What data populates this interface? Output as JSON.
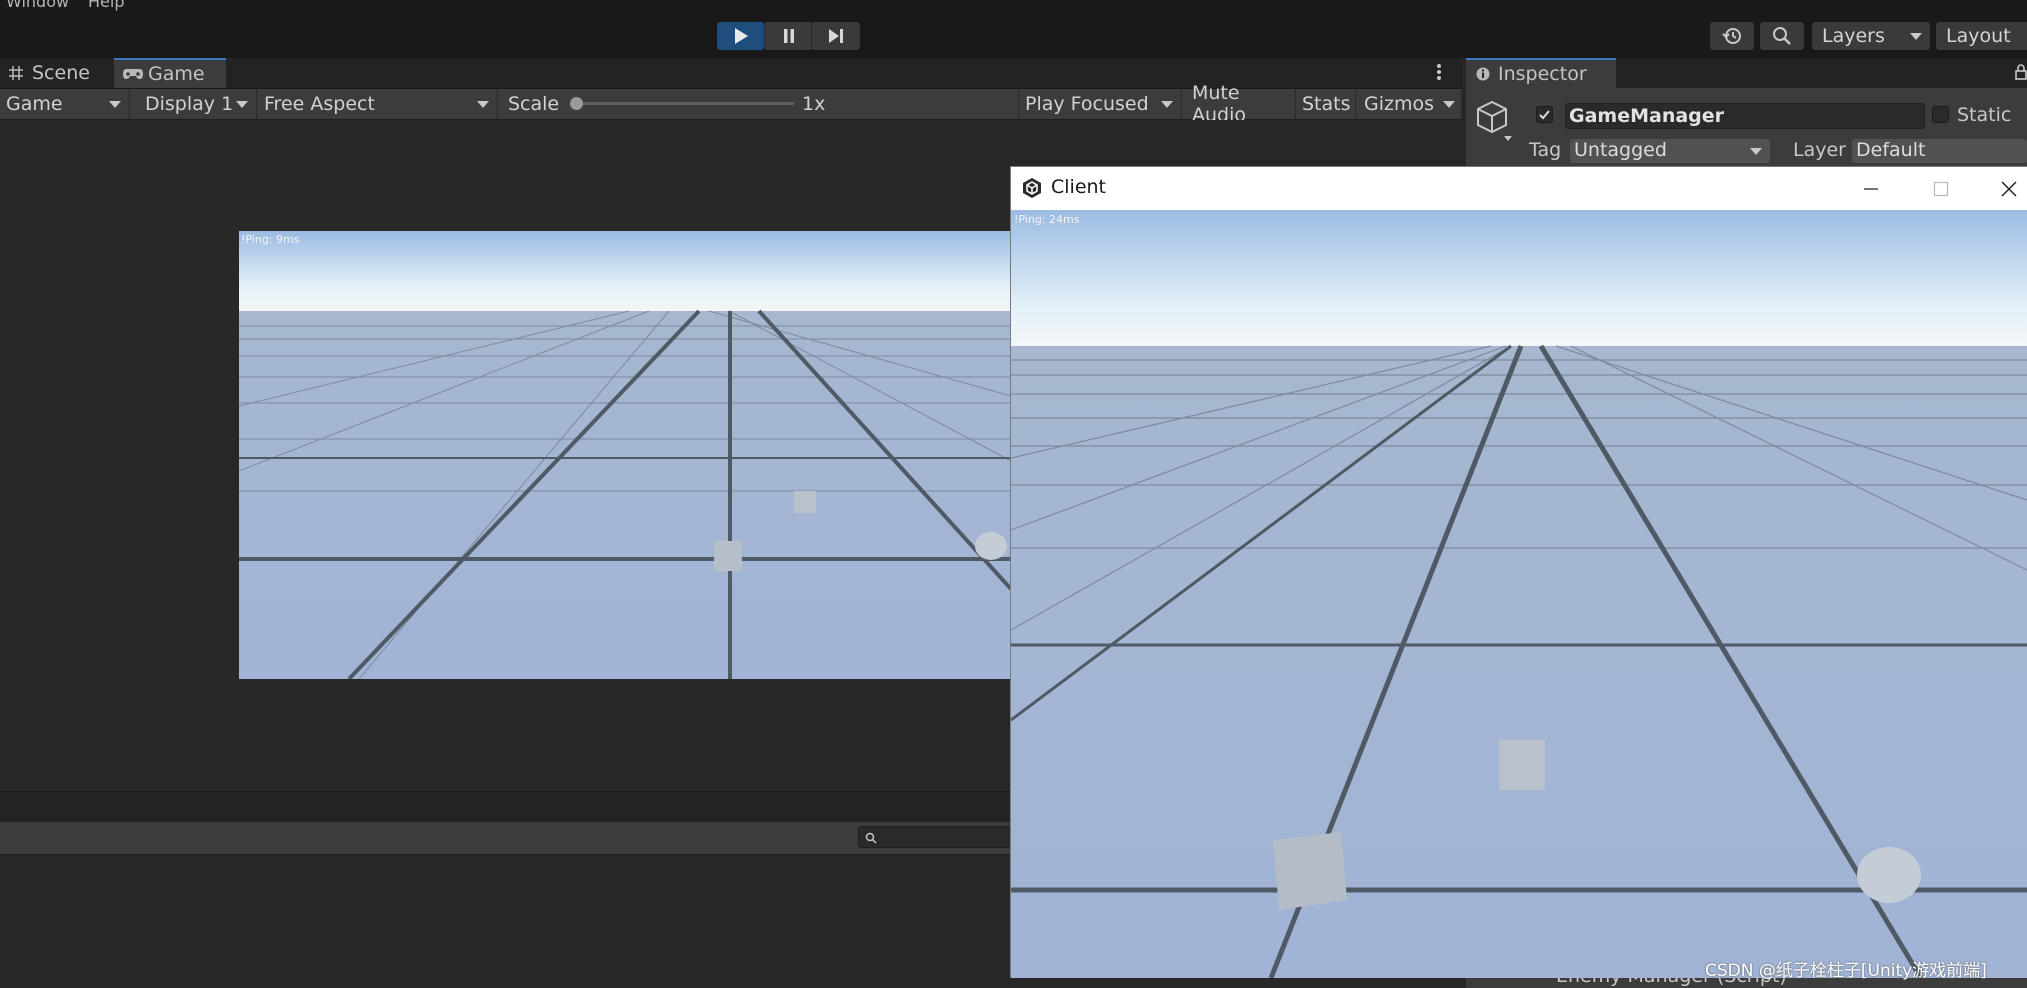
{
  "menu": {
    "items": [
      "Window",
      "Help"
    ]
  },
  "toolbar": {
    "play_icon": "play-icon",
    "pause_icon": "pause-icon",
    "step_icon": "step-icon",
    "history_icon": "history-icon",
    "search_icon": "search-icon",
    "layers_label": "Layers",
    "layout_label": "Layout",
    "accent": "#1e4d7e"
  },
  "tabs": {
    "scene": "Scene",
    "game": "Game"
  },
  "game_toolbar": {
    "mode": "Game",
    "display": "Display 1",
    "aspect": "Free Aspect",
    "scale_label": "Scale",
    "scale_value": "1x",
    "play_focused": "Play Focused",
    "mute_audio": "Mute Audio",
    "stats": "Stats",
    "gizmos": "Gizmos"
  },
  "game_view": {
    "ping": "!Ping: 9ms"
  },
  "inspector": {
    "tab_label": "Inspector",
    "object_name": "GameManager",
    "static_label": "Static",
    "tag_label": "Tag",
    "tag_value": "Untagged",
    "layer_label": "Layer",
    "layer_value": "Default",
    "component_partial": "Enemy Manager (Script)"
  },
  "client_window": {
    "title": "Client",
    "ping": "!Ping: 24ms"
  },
  "watermark": "CSDN @纸子栓柱子[Unity游戏前端]"
}
